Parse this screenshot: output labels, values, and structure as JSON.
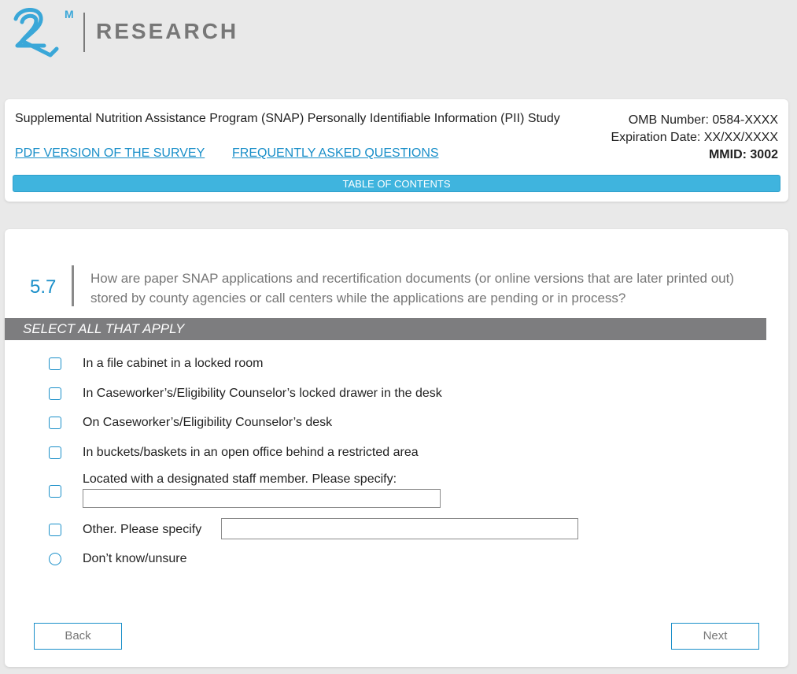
{
  "logo": {
    "mark_superscript": "M",
    "wordmark": "RESEARCH"
  },
  "header": {
    "study_title": "Supplemental Nutrition Assistance Program (SNAP) Personally Identifiable Information (PII) Study",
    "links": {
      "pdf": "PDF VERSION OF THE SURVEY",
      "faq": "FREQUENTLY ASKED QUESTIONS"
    },
    "omb_number": "OMB Number: 0584-XXXX",
    "expiration": "Expiration Date: XX/XX/XXXX",
    "mmid": "MMID: 3002",
    "toc_label": "TABLE OF CONTENTS"
  },
  "question": {
    "number": "5.7",
    "text": "How are paper SNAP applications and recertification documents (or online versions that are later printed out) stored by county agencies or call centers while the applications are pending or in process?",
    "instruction": "SELECT ALL THAT APPLY",
    "options": [
      {
        "label": "In a file cabinet in a locked room",
        "type": "checkbox",
        "checked": false
      },
      {
        "label": "In Caseworker’s/Eligibility Counselor’s locked drawer in the desk",
        "type": "checkbox",
        "checked": false
      },
      {
        "label": "On Caseworker’s/Eligibility Counselor’s desk",
        "type": "checkbox",
        "checked": false
      },
      {
        "label": "In buckets/baskets in an open office behind a restricted area",
        "type": "checkbox",
        "checked": false
      },
      {
        "label": "Located with a designated staff member. Please specify:",
        "type": "checkbox",
        "checked": false,
        "specify_value": ""
      },
      {
        "label": "Other. Please specify",
        "type": "checkbox",
        "checked": false,
        "specify_value": ""
      },
      {
        "label": "Don’t know/unsure",
        "type": "radio",
        "checked": false
      }
    ]
  },
  "nav": {
    "back": "Back",
    "next": "Next"
  },
  "colors": {
    "accent": "#1a8fc9",
    "toc_bar": "#3fb4de",
    "instruction_bar": "#7d7d7f",
    "background": "#e9e9e9"
  }
}
